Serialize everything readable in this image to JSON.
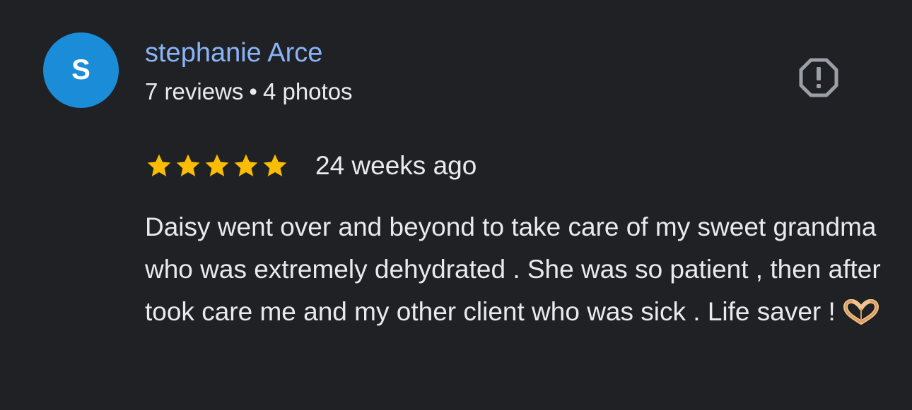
{
  "review": {
    "author": {
      "initial": "S",
      "name": "stephanie Arce",
      "reviews_count": "7 reviews",
      "separator": "•",
      "photos_count": "4 photos",
      "avatar_color": "#1a8cd8"
    },
    "rating": {
      "value": 5,
      "max": 5,
      "star_color": "#fbbc04"
    },
    "date": "24 weeks ago",
    "text": "Daisy went over and beyond to take care of my sweet grandma who was extremely dehydrated . She was so patient , then after took care me and my other client who was sick . Life saver !",
    "emoji": "heart-hands-emoji",
    "report_icon": "report-octagon-icon"
  },
  "colors": {
    "background": "#202124",
    "name": "#8ab4f8",
    "text": "#e8eaed",
    "icon": "#9aa0a6"
  }
}
